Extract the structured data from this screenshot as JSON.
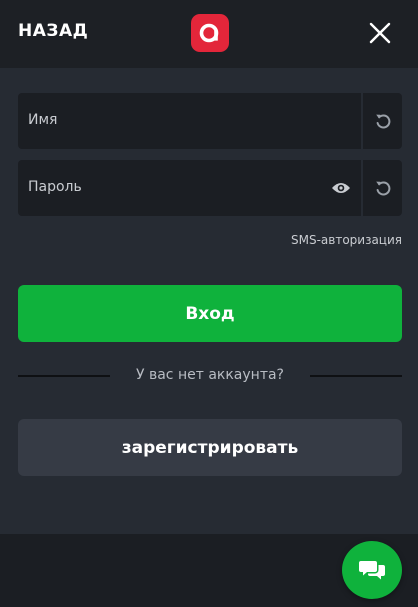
{
  "header": {
    "back_label": "НАЗАД",
    "logo_icon": "brand-logo-icon",
    "close_icon": "close-icon"
  },
  "form": {
    "name_field": {
      "placeholder": "Имя",
      "reset_icon": "undo-icon"
    },
    "password_field": {
      "placeholder": "Пароль",
      "visibility_icon": "eye-icon",
      "reset_icon": "undo-icon"
    },
    "sms_link": "SMS-авторизация",
    "login_button": "Вход",
    "no_account_text": "У вас нет аккаунта?",
    "register_button": "зарегистрировать"
  },
  "chat": {
    "icon": "chat-bubbles-icon"
  },
  "colors": {
    "brand_red": "#e3263a",
    "primary_green": "#0fb23c",
    "panel_bg": "#262b33",
    "input_bg": "#1b1e23",
    "secondary_button_bg": "#363b45"
  }
}
